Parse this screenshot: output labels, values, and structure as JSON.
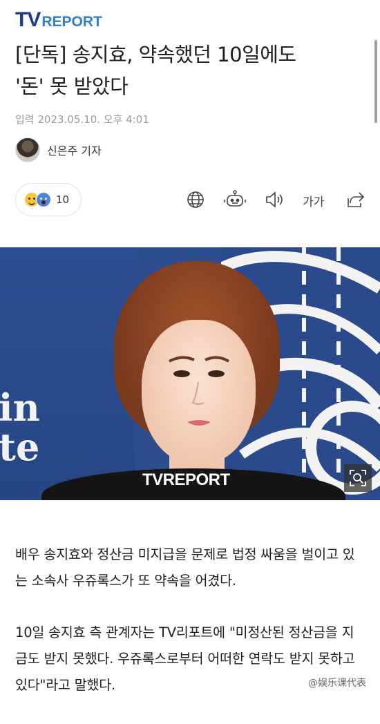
{
  "brand": {
    "logo_tv": "TV",
    "logo_report": "REPORT"
  },
  "article": {
    "headline_line1": "[단독] 송지효, 약속했던 10일에도",
    "headline_line2": "'돈' 못 받았다",
    "dateline": "입력 2023.05.10. 오후 4:01",
    "reporter": "신은주 기자",
    "paragraphs": [
      "배우 송지효와 정산금 미지급을 문제로 법정 싸움을 벌이고 있는 소속사 우쥬록스가 또 약속을 어겼다.",
      "10일 송지효 측 관계자는 TV리포트에 \"미정산된 정산금을 지금도 받지 못했다. 우쥬록스로부터 어떠한 연락도 받지 못하고 있다\"라고 말했다."
    ]
  },
  "toolbar": {
    "reaction_count": "10",
    "font_size_label": "가가",
    "icons": [
      "globe-icon",
      "robot-icon",
      "speaker-icon",
      "font-size-icon",
      "share-icon"
    ]
  },
  "photo": {
    "watermark": "TVREPORT",
    "wall_text_line1": "in",
    "wall_text_line2": "te"
  },
  "overlay": {
    "weibo_watermark": "@娱乐课代表"
  },
  "colors": {
    "brand_blue": "#1f3b8f",
    "brand_teal": "#27b7a6",
    "report_blue": "#2d7fd3"
  }
}
